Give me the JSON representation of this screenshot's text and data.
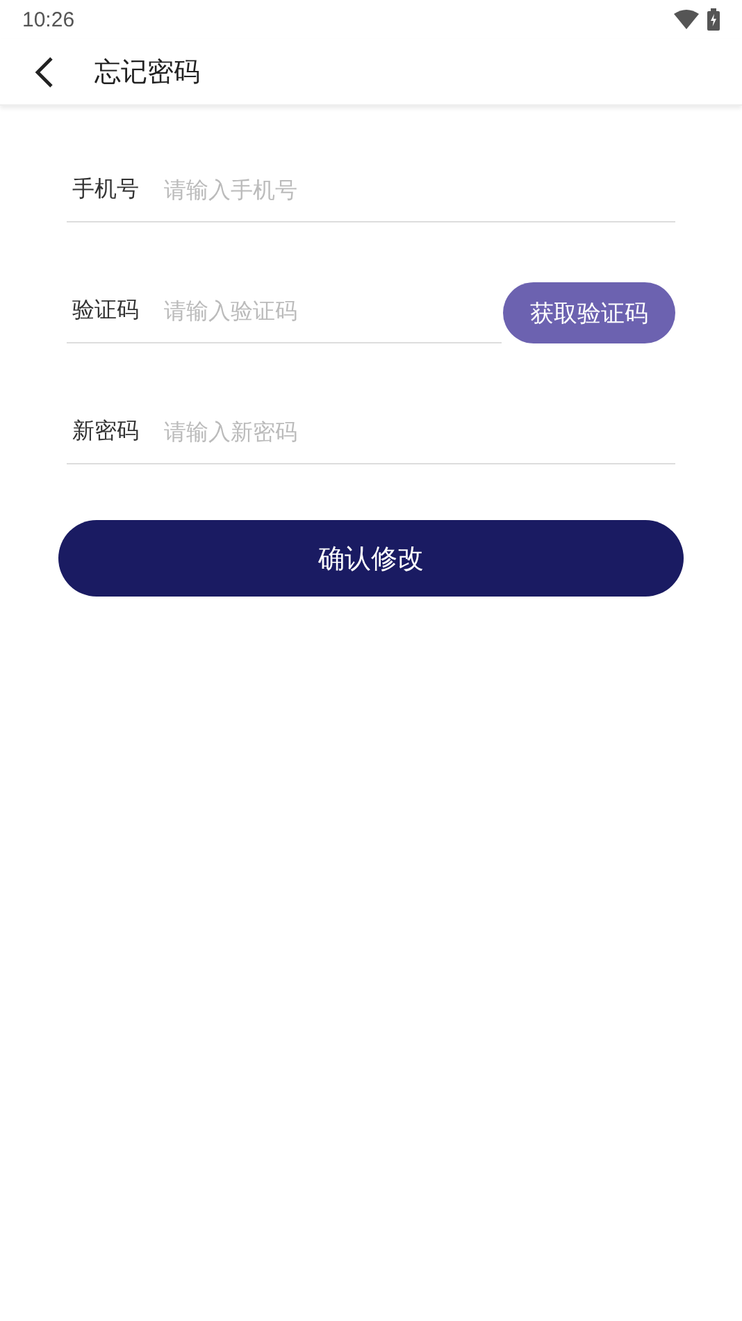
{
  "status_bar": {
    "time": "10:26"
  },
  "app_bar": {
    "title": "忘记密码"
  },
  "fields": [
    {
      "label": "手机号",
      "placeholder": "请输入手机号"
    },
    {
      "label": "验证码",
      "placeholder": "请输入验证码",
      "button": "获取验证码"
    },
    {
      "label": "新密码",
      "placeholder": "请输入新密码"
    }
  ],
  "submit_button": "确认修改"
}
